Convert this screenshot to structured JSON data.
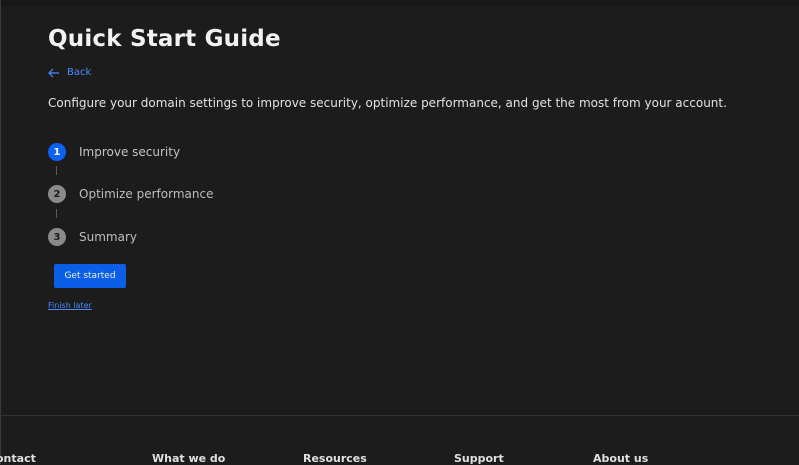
{
  "page": {
    "title": "Quick Start Guide",
    "back_label": "Back",
    "description": "Configure your domain settings to improve security, optimize performance, and get the most from your account."
  },
  "steps": [
    {
      "number": "1",
      "label": "Improve security",
      "state": "active"
    },
    {
      "number": "2",
      "label": "Optimize performance",
      "state": "pending"
    },
    {
      "number": "3",
      "label": "Summary",
      "state": "pending"
    }
  ],
  "actions": {
    "primary_label": "Get started",
    "secondary_label": "Finish later"
  },
  "footer": {
    "columns": [
      "ontact",
      "What we do",
      "Resources",
      "Support",
      "About us"
    ]
  },
  "colors": {
    "background": "#1c1c1c",
    "accent": "#0b5ee6",
    "link": "#4a8bff",
    "step_pending": "#8a8a8a"
  },
  "icons": {
    "back": "arrow-left-icon"
  }
}
